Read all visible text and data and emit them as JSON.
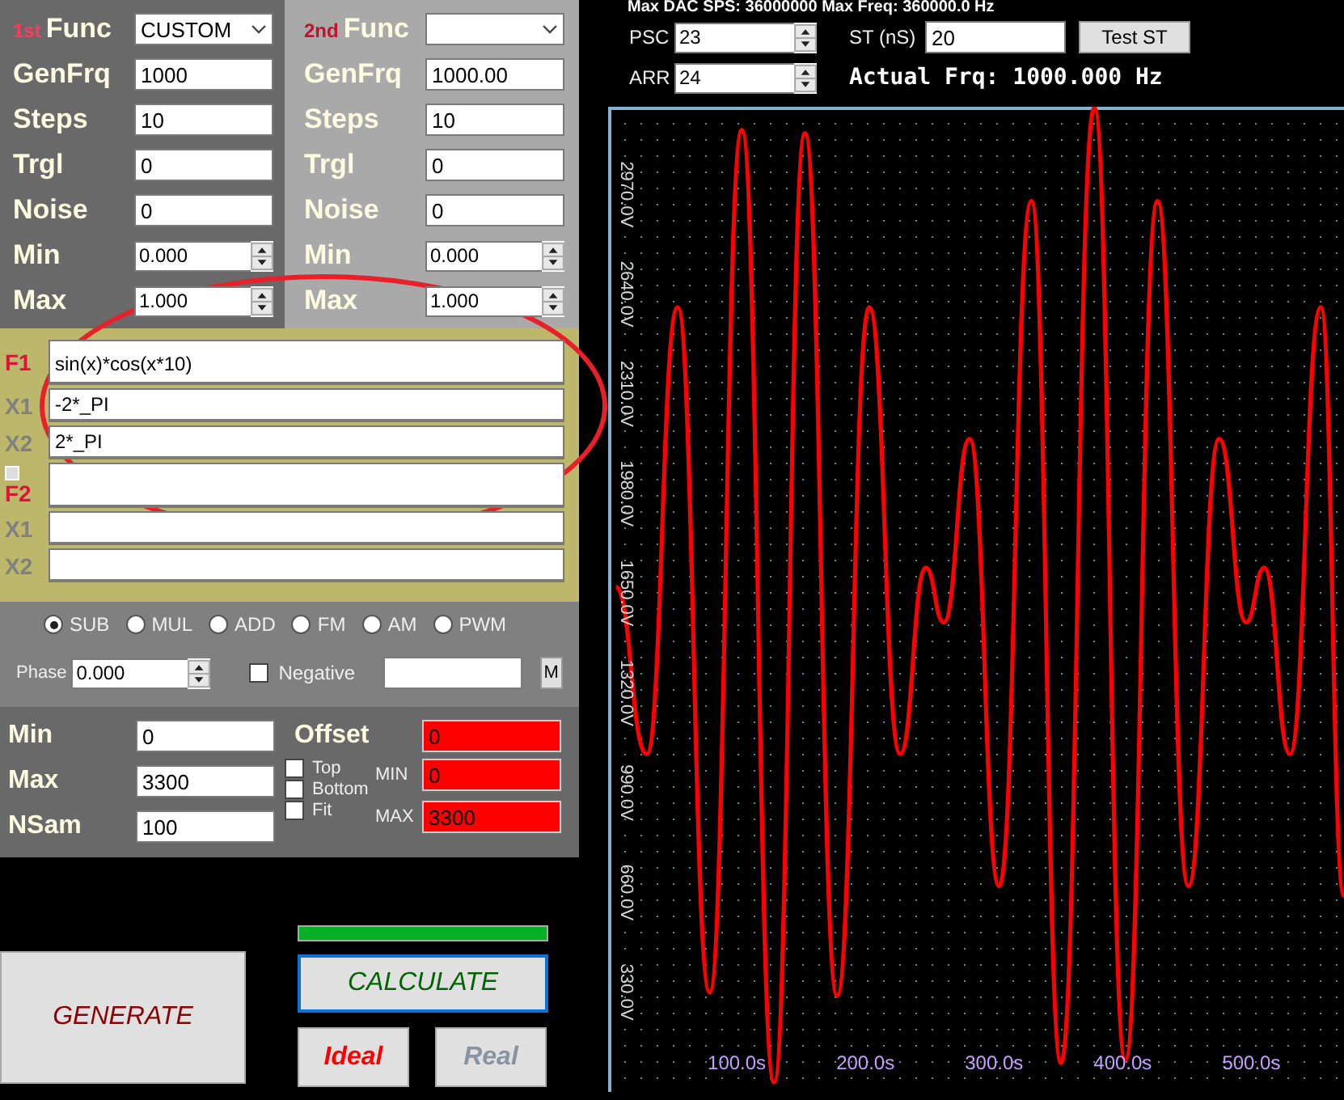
{
  "channels": [
    {
      "prefix": "1st",
      "fields": [
        {
          "label": "Func",
          "kind": "select",
          "value": "CUSTOM"
        },
        {
          "label": "GenFrq",
          "kind": "text",
          "value": "1000"
        },
        {
          "label": "Steps",
          "kind": "text",
          "value": "10"
        },
        {
          "label": "Trgl",
          "kind": "text",
          "value": "0"
        },
        {
          "label": "Noise",
          "kind": "text",
          "value": "0"
        },
        {
          "label": "Min",
          "kind": "spin",
          "value": "0.000"
        },
        {
          "label": "Max",
          "kind": "spin",
          "value": "1.000"
        }
      ]
    },
    {
      "prefix": "2nd",
      "fields": [
        {
          "label": "Func",
          "kind": "select"
        },
        {
          "label": "GenFrq",
          "kind": "text",
          "value": "1000.00"
        },
        {
          "label": "Steps",
          "kind": "text",
          "value": "10"
        },
        {
          "label": "Trgl",
          "kind": "text",
          "value": "0"
        },
        {
          "label": "Noise",
          "kind": "text",
          "value": "0"
        },
        {
          "label": "Min",
          "kind": "spin",
          "value": "0.000"
        },
        {
          "label": "Max",
          "kind": "spin",
          "value": "1.000"
        }
      ]
    }
  ],
  "formulas": [
    {
      "label": "F1",
      "kind": "func",
      "value": "sin(x)*cos(x*10)"
    },
    {
      "label": "X1",
      "kind": "bound",
      "value": "-2*_PI"
    },
    {
      "label": "X2",
      "kind": "bound",
      "value": "2*_PI"
    },
    {
      "label": "F2",
      "kind": "func",
      "toggle": {
        "checked": false
      }
    },
    {
      "label": "X1",
      "kind": "bound"
    },
    {
      "label": "X2",
      "kind": "bound"
    }
  ],
  "modes": [
    {
      "label": "SUB",
      "selected": true
    },
    {
      "label": "MUL",
      "selected": false
    },
    {
      "label": "ADD",
      "selected": false
    },
    {
      "label": "FM",
      "selected": false
    },
    {
      "label": "AM",
      "selected": false
    },
    {
      "label": "PWM",
      "selected": false
    }
  ],
  "phase": {
    "label": "Phase",
    "value": "0.000"
  },
  "negative": {
    "label": "Negative",
    "checked": false
  },
  "m_button": "M",
  "output": {
    "rows": [
      {
        "label": "Min",
        "value": "0"
      },
      {
        "label": "Max",
        "value": "3300"
      },
      {
        "label": "NSam",
        "value": "100"
      }
    ],
    "offset": {
      "label": "Offset",
      "value": "0"
    },
    "options": [
      {
        "label": "Top",
        "checked": false
      },
      {
        "label": "Bottom",
        "checked": false
      },
      {
        "label": "Fit",
        "checked": false
      }
    ],
    "limits": [
      {
        "label": "MIN",
        "value": "0"
      },
      {
        "label": "MAX",
        "value": "3300"
      }
    ]
  },
  "progress": {
    "level": 1
  },
  "buttons": {
    "generate": "GENERATE",
    "calculate": "CALCULATE"
  },
  "view_modes": [
    {
      "label": "Ideal",
      "selected": true
    },
    {
      "label": "Real",
      "selected": false
    }
  ],
  "header": {
    "info": "Max DAC SPS: 36000000 Max Freq: 360000.0 Hz",
    "psc": {
      "label": "PSC",
      "value": "23"
    },
    "arr": {
      "label": "ARR",
      "value": "24"
    },
    "st": {
      "label": "ST (nS)",
      "value": "20"
    },
    "test_button": "Test ST",
    "actual": "Actual Frq: 1000.000 Hz"
  },
  "plot": {
    "chart_data": {
      "type": "line",
      "xlim": [
        0,
        572
      ],
      "ylim": [
        0,
        3260
      ],
      "xticks": [
        {
          "value": 100,
          "label": "100.0s"
        },
        {
          "value": 200,
          "label": "200.0s"
        },
        {
          "value": 300,
          "label": "300.0s"
        },
        {
          "value": 400,
          "label": "400.0s"
        },
        {
          "value": 500,
          "label": "500.0s"
        }
      ],
      "yticks": [
        {
          "value": 330,
          "label": "330.0V"
        },
        {
          "value": 660,
          "label": "660.0V"
        },
        {
          "value": 990,
          "label": "990.0V"
        },
        {
          "value": 1320,
          "label": "1320.0V"
        },
        {
          "value": 1650,
          "label": "1650.0V"
        },
        {
          "value": 1980,
          "label": "1980.0V"
        },
        {
          "value": 2310,
          "label": "2310.0V"
        },
        {
          "value": 2640,
          "label": "2640.0V"
        },
        {
          "value": 2970,
          "label": "2970.0V"
        }
      ],
      "x": [
        6,
        30,
        54,
        79,
        104,
        129,
        153,
        178,
        203,
        227,
        247,
        261,
        281,
        304,
        329,
        352,
        378,
        402,
        427,
        451,
        475,
        496,
        510,
        530,
        554,
        572
      ],
      "series": [
        {
          "color": "#ff0000",
          "values": [
            1671,
            1118,
            2597,
            330,
            3183,
            32,
            3172,
            319,
            2597,
            1118,
            1735,
            1554,
            2161,
            681,
            2948,
            96,
            3257,
            106,
            2948,
            681,
            2161,
            1554,
            1735,
            1118,
            2597,
            649
          ]
        }
      ]
    }
  },
  "annotations": [
    {
      "kind": "ellipse"
    }
  ]
}
